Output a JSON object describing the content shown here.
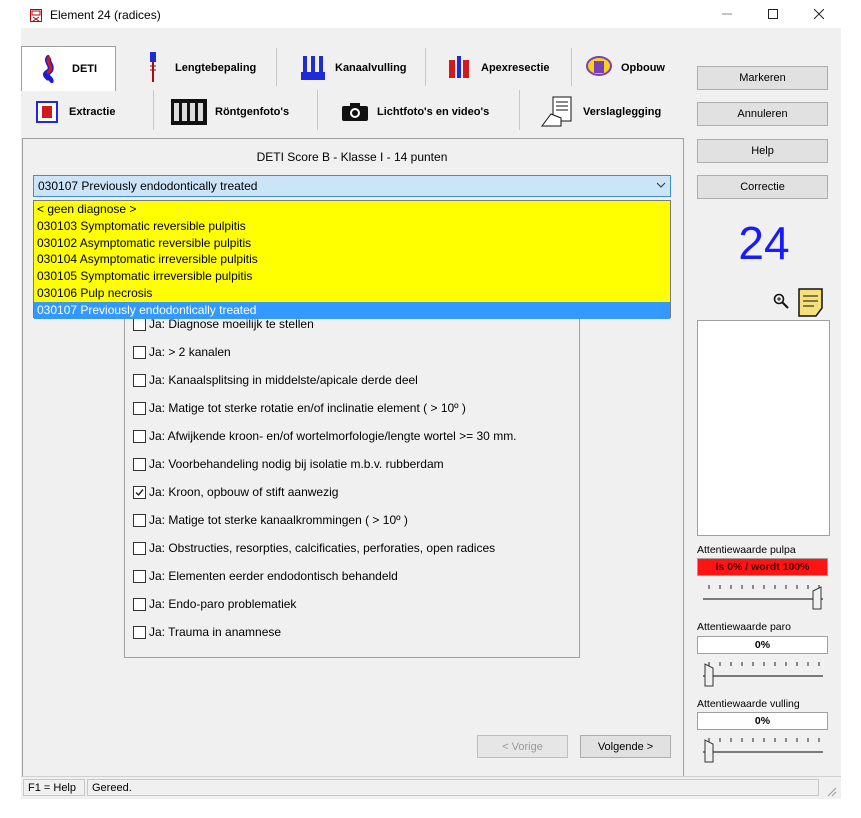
{
  "window": {
    "title": "Element 24 (radices)"
  },
  "tabs_row1": [
    {
      "label": "DETI",
      "icon": "tooth-marker-icon",
      "active": true
    },
    {
      "label": "Lengtebepaling",
      "icon": "file-instrument-icon"
    },
    {
      "label": "Kanaalvulling",
      "icon": "canal-filling-icon"
    },
    {
      "label": "Apexresectie",
      "icon": "apex-resection-icon"
    },
    {
      "label": "Opbouw",
      "icon": "buildup-icon"
    }
  ],
  "tabs_row2": [
    {
      "label": "Extractie",
      "icon": "extraction-icon"
    },
    {
      "label": "Röntgenfoto's",
      "icon": "xray-icon"
    },
    {
      "label": "Lichtfoto's en video's",
      "icon": "camera-icon"
    },
    {
      "label": "Verslaglegging",
      "icon": "report-icon"
    }
  ],
  "side_buttons": {
    "markeren": "Markeren",
    "annuleren": "Annuleren",
    "help": "Help",
    "correctie": "Correctie"
  },
  "score_title": "DETI Score B - Klasse I - 14 punten",
  "diagnosis": {
    "selected": "030107 Previously endodontically treated",
    "options": [
      "< geen diagnose >",
      "030103 Symptomatic reversible pulpitis",
      "030102 Asymptomatic reversible pulpitis",
      "030104 Asymptomatic irreversible pulpitis",
      "030105 Symptomatic irreversible pulpitis",
      "030106 Pulp necrosis",
      "030107 Previously endodontically treated"
    ]
  },
  "checklist": [
    {
      "label": "Ja: Diagnose moeilijk te stellen",
      "checked": false
    },
    {
      "label": "Ja: > 2 kanalen",
      "checked": false
    },
    {
      "label": "Ja: Kanaalsplitsing in middelste/apicale derde deel",
      "checked": false
    },
    {
      "label": "Ja: Matige tot sterke rotatie en/of inclinatie element ( > 10º )",
      "checked": false
    },
    {
      "label": "Ja: Afwijkende kroon- en/of wortelmorfologie/lengte wortel >= 30 mm.",
      "checked": false
    },
    {
      "label": "Ja: Voorbehandeling nodig bij isolatie m.b.v. rubberdam",
      "checked": false
    },
    {
      "label": "Ja: Kroon, opbouw of stift aanwezig",
      "checked": true
    },
    {
      "label": "Ja: Matige tot sterke kanaalkrommingen ( > 10º )",
      "checked": false
    },
    {
      "label": "Ja: Obstructies, resorpties, calcificaties, perforaties, open radices",
      "checked": false
    },
    {
      "label": "Ja: Elementen eerder endodontisch behandeld",
      "checked": false
    },
    {
      "label": "Ja: Endo-paro problematiek",
      "checked": false
    },
    {
      "label": "Ja: Trauma in anamnese",
      "checked": false
    }
  ],
  "nav": {
    "prev": "< Vorige",
    "next": "Volgende >"
  },
  "element_number": "24",
  "attention": {
    "pulpa": {
      "label": "Attentiewaarde pulpa",
      "value": "Is 0% / wordt 100%",
      "level": 1.0
    },
    "paro": {
      "label": "Attentiewaarde paro",
      "value": "0%",
      "level": 0.0
    },
    "vulling": {
      "label": "Attentiewaarde vulling",
      "value": "0%",
      "level": 0.0
    }
  },
  "status": {
    "help": "F1 = Help",
    "message": "Gereed."
  },
  "colors": {
    "dropdown_bg": "#ffff00",
    "selected_bg": "#3399ff",
    "number": "#1a1aff",
    "alert": "#ff1414"
  }
}
